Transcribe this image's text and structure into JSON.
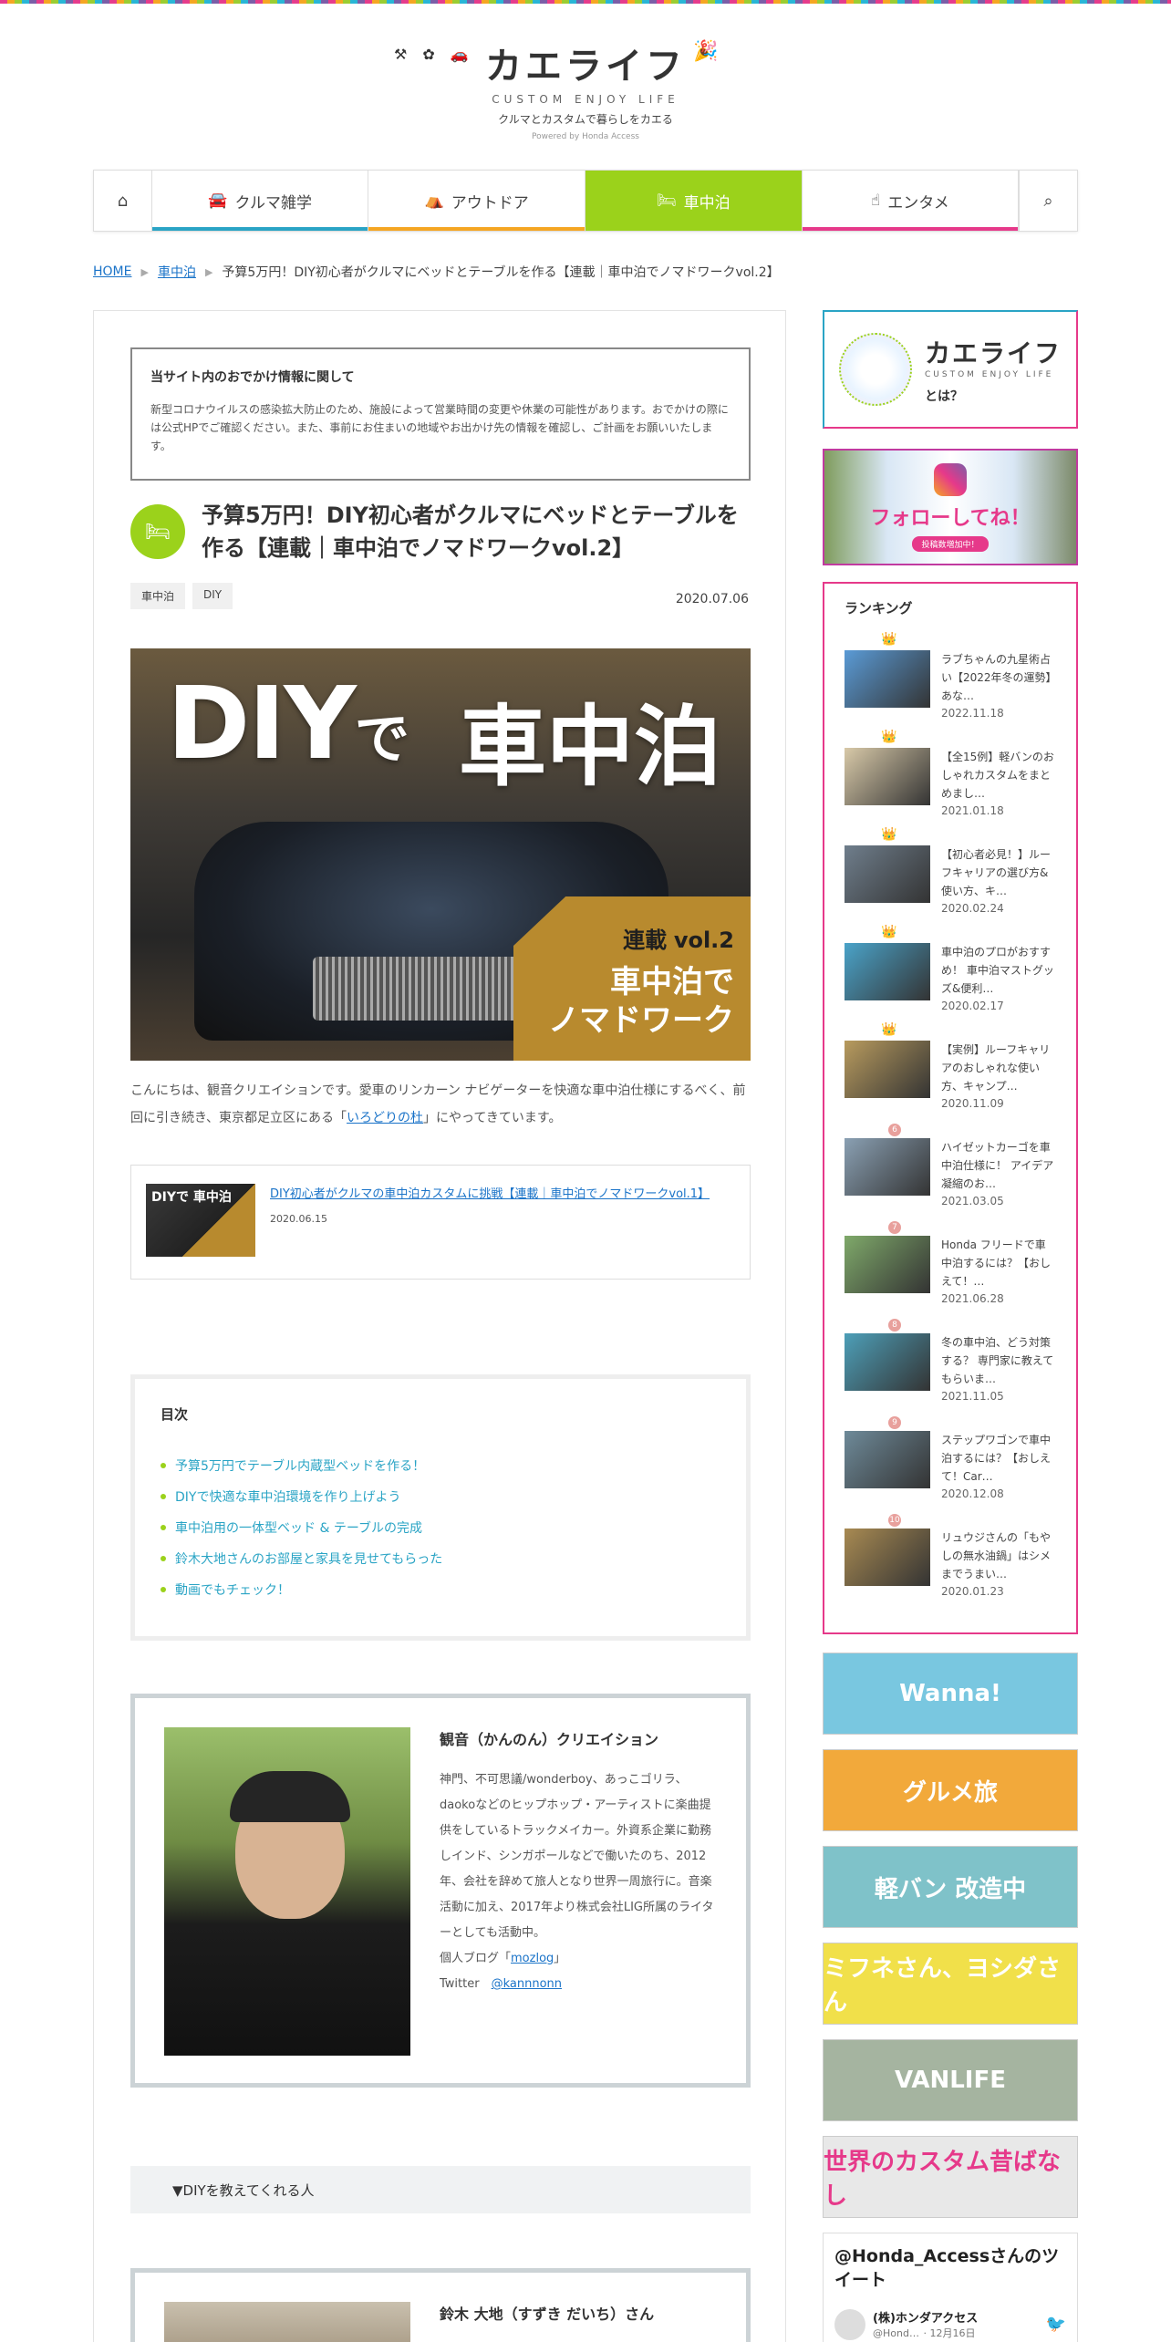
{
  "site": {
    "logo": "カエライフ",
    "subtitle": "CUSTOM ENJOY LIFE",
    "tagline": "クルマとカスタムで暮らしをカエる",
    "powered": "Powered by Honda Access"
  },
  "nav": {
    "items": [
      {
        "label": "クルマ雑学",
        "icon": "car-icon",
        "color": "#2aa4c5"
      },
      {
        "label": "アウトドア",
        "icon": "tent-icon",
        "color": "#f5a623"
      },
      {
        "label": "車中泊",
        "icon": "car-bed-icon",
        "color": "#9bd21b"
      },
      {
        "label": "エンタメ",
        "icon": "hand-pointer-icon",
        "color": "#e6398a"
      }
    ],
    "active_index": 2
  },
  "breadcrumb": {
    "home": "HOME",
    "category": "車中泊",
    "current": "予算5万円！DIY初心者がクルマにベッドとテーブルを作る【連載｜車中泊でノマドワークvol.2】"
  },
  "notice": {
    "title": "当サイト内のおでかけ情報に関して",
    "body": "新型コロナウイルスの感染拡大防止のため、施設によって営業時間の変更や休業の可能性があります。おでかけの際には公式HPでご確認ください。また、事前にお住まいの地域やお出かけ先の情報を確認し、ご計画をお願いいたします。"
  },
  "article": {
    "title": "予算5万円！DIY初心者がクルマにベッドとテーブルを作る【連載｜車中泊でノマドワークvol.2】",
    "tags": [
      "車中泊",
      "DIY"
    ],
    "date": "2020.07.06",
    "hero": {
      "t1": "DIY",
      "t1_small": "で",
      "t2": "車中泊",
      "badge_series": "連載",
      "badge_vol": "vol.2",
      "badge_line1": "車中泊で",
      "badge_line2": "ノマドワーク"
    },
    "intro_before": "こんにちは、観音クリエイションです。愛車のリンカーン ナビゲーターを快適な車中泊仕様にするべく、前回に引き続き、東京都足立区にある「",
    "intro_link": "いろどりの杜",
    "intro_after": "」にやってきています。"
  },
  "related": {
    "thumb_text": "DIYで 車中泊",
    "link": "DIY初心者がクルマの車中泊カスタムに挑戦【連載｜車中泊でノマドワークvol.1】",
    "date": "2020.06.15"
  },
  "toc": {
    "title": "目次",
    "items": [
      "予算5万円でテーブル内蔵型ベッドを作る！",
      "DIYで快適な車中泊環境を作り上げよう",
      "車中泊用の一体型ベッド & テーブルの完成",
      "鈴木大地さんのお部屋と家具を見せてもらった",
      "動画でもチェック！"
    ]
  },
  "author": {
    "name": "観音（かんのん）クリエイション",
    "bio": "神門、不可思議/wonderboy、あっこゴリラ、daokoなどのヒップホップ・アーティストに楽曲提供をしているトラックメイカー。外資系企業に勤務しインド、シンガポールなどで働いたのち、2012年、会社を辞めて旅人となり世界一周旅行に。音楽活動に加え、2017年より株式会社LIG所属のライターとしても活動中。",
    "blog_label": "個人ブログ「",
    "blog_link": "mozlog",
    "blog_end": "」",
    "twitter_label": "Twitter",
    "twitter_link": "@kannnonn"
  },
  "section_bar": "▼DIYを教えてくれる人",
  "author2": {
    "name": "鈴木 大地（すずき だいち）さん"
  },
  "sidebar": {
    "about": {
      "logo": "カエライフ",
      "sub": "CUSTOM ENJOY LIFE",
      "text": "とは？"
    },
    "insta": {
      "text": "フォローしてね！",
      "btn": "投稿数増加中！"
    },
    "ranking": {
      "title": "ランキング",
      "items": [
        {
          "badge": "👑",
          "text": "ラブちゃんの九星術占い【2022年冬の運勢】あな…",
          "date": "2022.11.18",
          "color": "#5a9bd6"
        },
        {
          "badge": "👑",
          "text": "【全15例】軽バンのおしゃれカスタムをまとめまし…",
          "date": "2021.01.18",
          "color": "#d8c9a8"
        },
        {
          "badge": "👑",
          "text": "【初心者必見！】ルーフキャリアの選び方&使い方、キ…",
          "date": "2020.02.24",
          "color": "#6f7e8c"
        },
        {
          "badge": "👑",
          "text": "車中泊のプロがおすすめ！ 車中泊マストグッズ&便利…",
          "date": "2020.02.17",
          "color": "#4aa3c9"
        },
        {
          "badge": "👑",
          "text": "【実例】ルーフキャリアのおしゃれな使い方、キャンプ…",
          "date": "2020.11.09",
          "color": "#b89b5e"
        },
        {
          "badge": "6",
          "text": "ハイゼットカーゴを車中泊仕様に！ アイデア凝縮のお…",
          "date": "2021.03.05",
          "color": "#8aa0b3"
        },
        {
          "badge": "7",
          "text": "Honda フリードで車中泊するには？【おしえて！…",
          "date": "2021.06.28",
          "color": "#7fa96a"
        },
        {
          "badge": "8",
          "text": "冬の車中泊、どう対策する？ 専門家に教えてもらいま…",
          "date": "2021.11.05",
          "color": "#4d9fb8"
        },
        {
          "badge": "9",
          "text": "ステップワゴンで車中泊するには？【おしえて！Car…",
          "date": "2020.12.08",
          "color": "#6e8a99"
        },
        {
          "badge": "10",
          "text": "リュウジさんの「もやしの無水油鍋」はシメまでうまい…",
          "date": "2020.01.23",
          "color": "#a88a52"
        }
      ]
    },
    "banners": [
      {
        "label": "Wanna!",
        "bg": "#79c7e0"
      },
      {
        "label": "グルメ旅",
        "bg": "#f2a93b"
      },
      {
        "label": "軽バン 改造中",
        "bg": "#7fc2c9"
      },
      {
        "label": "ミフネさん、ヨシダさん",
        "bg": "#f1e04a"
      },
      {
        "label": "VANLIFE",
        "bg": "#a5b4a0"
      },
      {
        "label": "世界のカスタム昔ばなし",
        "bg": "#e8e8e8"
      }
    ],
    "twitter": {
      "title": "@Honda_Accessさんのツイート",
      "account": "(株)ホンダアクセス",
      "handle": "@Hond…",
      "time": "12月16日"
    }
  }
}
